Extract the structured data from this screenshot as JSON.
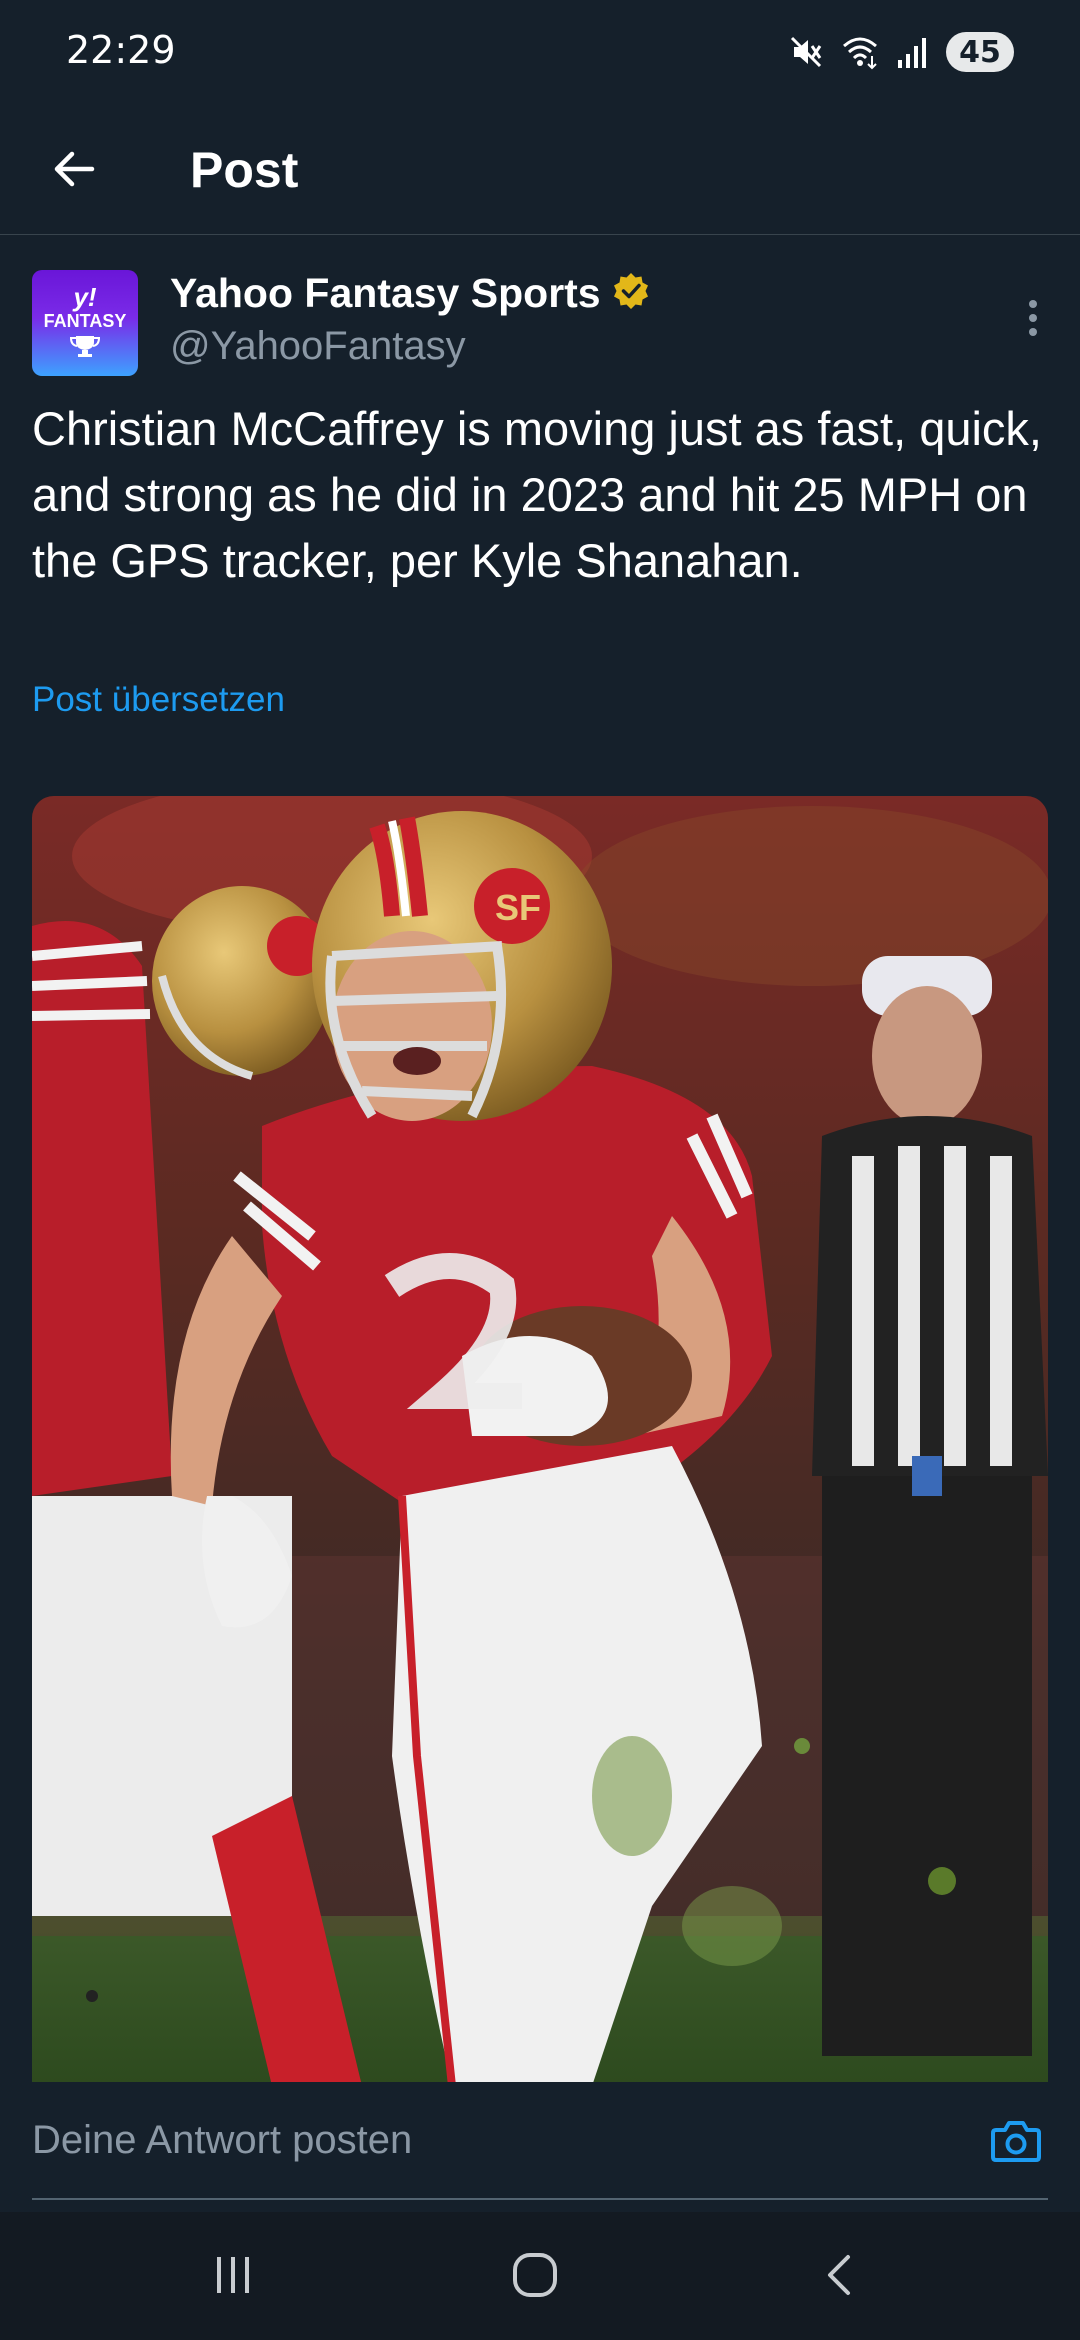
{
  "status_bar": {
    "time": "22:29",
    "battery_level": "45",
    "icons": [
      "mute-icon",
      "wifi-icon",
      "signal-icon",
      "battery-icon"
    ]
  },
  "header": {
    "title": "Post",
    "back_icon": "arrow-left-icon"
  },
  "post": {
    "author_name": "Yahoo Fantasy Sports",
    "author_handle": "@YahooFantasy",
    "verified_badge": "gold-verified-badge-icon",
    "avatar": {
      "mark": "y!",
      "label": "FANTASY"
    },
    "text": "Christian McCaffrey is moving just as fast, quick, and strong as he did in 2023 and hit 25 MPH on the GPS tracker, per Kyle Shanahan.",
    "translate_label": "Post übersetzen",
    "more_icon": "more-vertical-icon",
    "media": {
      "description_icon": "photo-football-player"
    }
  },
  "reply": {
    "placeholder": "Deine Antwort posten",
    "camera_icon": "camera-icon"
  },
  "nav_bar": {
    "recent_icon": "recent-apps-icon",
    "home_icon": "home-icon",
    "back_icon": "back-chevron-icon"
  },
  "colors": {
    "background": "#15202b",
    "accent": "#1d9bf0",
    "verified_gold": "#e2b719",
    "muted_text": "#8b98a5"
  }
}
